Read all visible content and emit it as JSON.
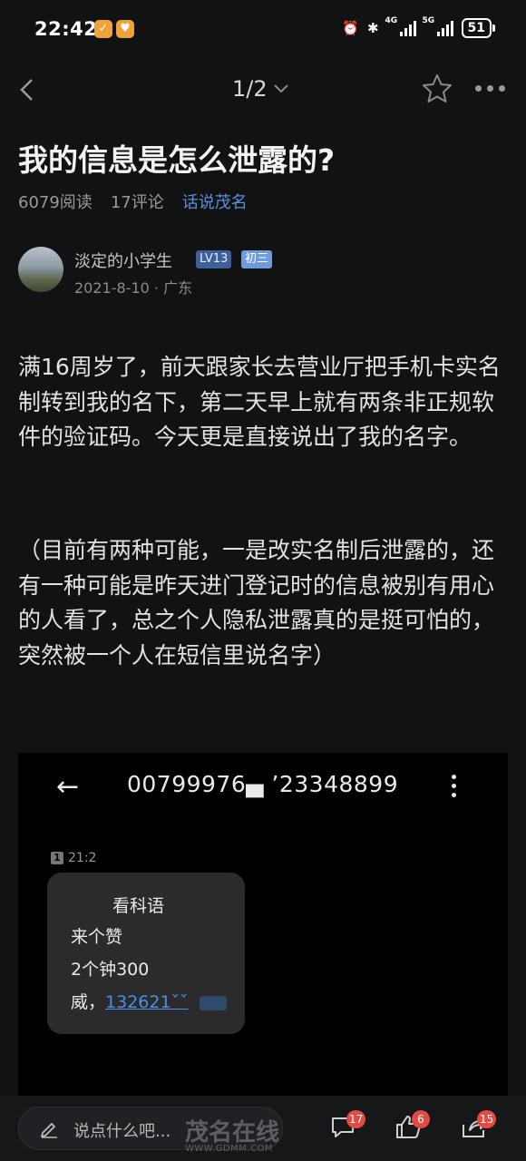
{
  "status_bar": {
    "time": "22:42",
    "network_4g": "4G",
    "network_5g": "5G",
    "battery": "51"
  },
  "nav": {
    "pager": "1/2"
  },
  "post": {
    "title": "我的信息是怎么泄露的?",
    "reads": "6079阅读",
    "comments": "17评论",
    "topic": "话说茂名",
    "author": {
      "name": "淡定的小学生",
      "level": "LV13",
      "grade": "初三",
      "date_location": "2021-8-10 · 广东"
    },
    "paragraphs": [
      "满16周岁了，前天跟家长去营业厅把手机卡实名制转到我的名下，第二天早上就有两条非正规软件的验证码。今天更是直接说出了我的名字。",
      "（目前有两种可能，一是改实名制后泄露的，还有一种可能是昨天进门登记时的信息被别有用心的人看了，总之个人隐私泄露真的是挺可怕的，突然被一个人在短信里说名字）"
    ]
  },
  "sms_screenshot": {
    "sender_number": "00799976▄ ’23348899",
    "sim_label": "1",
    "time": "21:2",
    "lines": [
      "看科语",
      "来个赞",
      "2个钟300"
    ],
    "phone_prefix": "威，",
    "phone": "132621ˇˇ"
  },
  "bottom_bar": {
    "comment_placeholder": "说点什么吧...",
    "comment_count": "17",
    "like_count": "6",
    "share_count": "15",
    "watermark_text": "茂名在线",
    "watermark_url": "WWW.GDMM.COM"
  },
  "colors": {
    "background": "#111214",
    "accent_blue": "#5b8fd9",
    "badge_red": "#e24a44"
  }
}
